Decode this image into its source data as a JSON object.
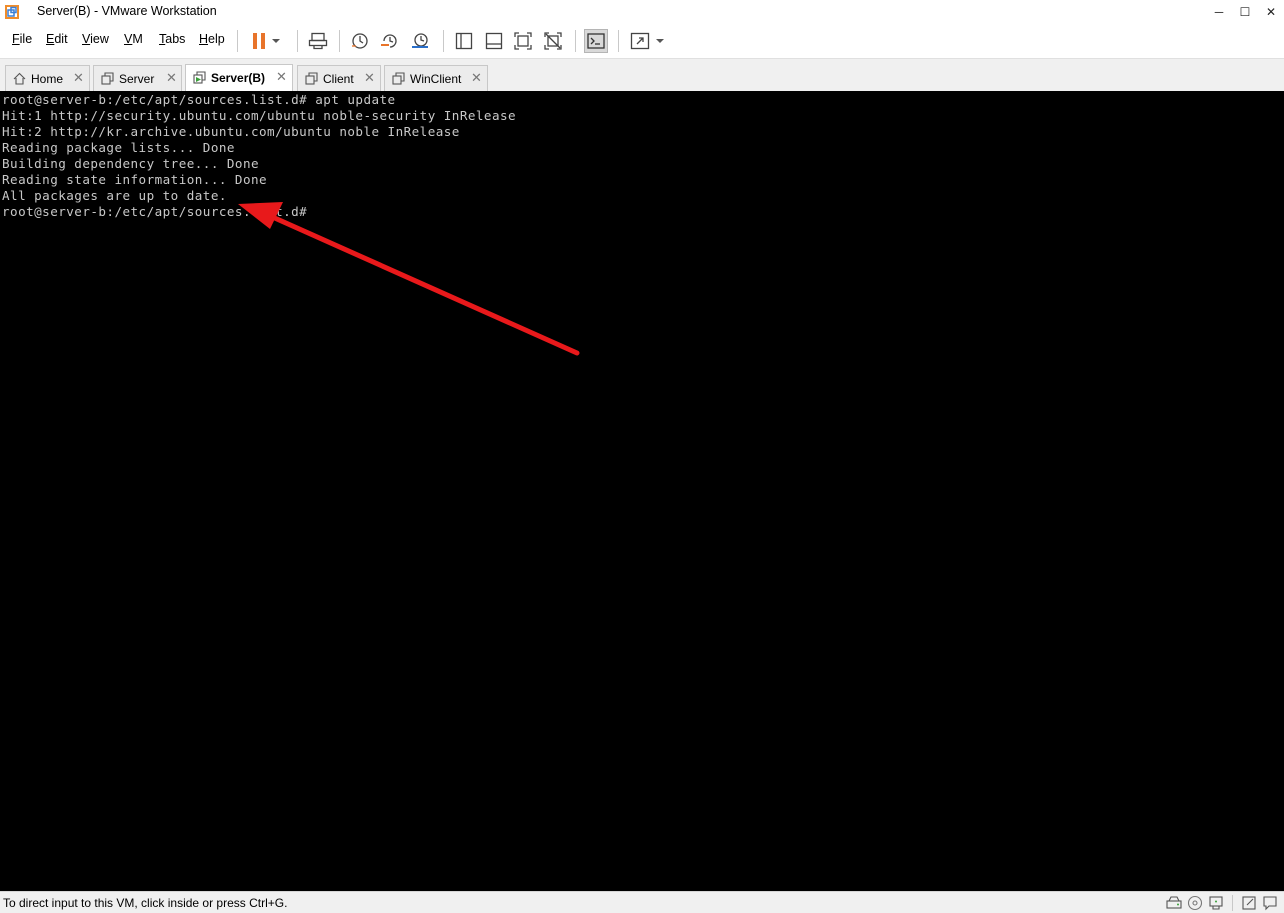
{
  "window": {
    "title": "Server(B) - VMware Workstation",
    "minimize": "─",
    "maximize": "☐",
    "close": "✕"
  },
  "menu": {
    "items": [
      {
        "label": "File",
        "mnemonic": "F",
        "rest": "ile"
      },
      {
        "label": "Edit",
        "mnemonic": "E",
        "rest": "dit"
      },
      {
        "label": "View",
        "mnemonic": "V",
        "rest": "iew"
      },
      {
        "label": "VM",
        "mnemonic": "V",
        "rest": "M"
      },
      {
        "label": "Tabs",
        "mnemonic": "T",
        "rest": "abs"
      },
      {
        "label": "Help",
        "mnemonic": "H",
        "rest": "elp"
      }
    ]
  },
  "toolbar": {
    "icons": [
      "pause-icon",
      "dropdown-icon",
      "send-ctrl-alt-del-icon",
      "snapshot-icon",
      "revert-snapshot-icon",
      "snapshot-manager-icon",
      "show-library-icon",
      "show-thumbnail-icon",
      "full-screen-icon",
      "unity-icon",
      "console-view-icon",
      "stretch-icon",
      "stretch-dropdown-icon"
    ],
    "accent": "#e8742a"
  },
  "tabs": [
    {
      "label": "Home",
      "icon": "home-icon",
      "selected": false
    },
    {
      "label": "Server",
      "icon": "vm-icon",
      "selected": false
    },
    {
      "label": "Server(B)",
      "icon": "vm-running-icon",
      "selected": true
    },
    {
      "label": "Client",
      "icon": "vm-icon",
      "selected": false
    },
    {
      "label": "WinClient",
      "icon": "vm-icon",
      "selected": false
    }
  ],
  "tab_close": "✕",
  "terminal": {
    "lines": [
      "root@server-b:/etc/apt/sources.list.d# apt update",
      "Hit:1 http://security.ubuntu.com/ubuntu noble-security InRelease",
      "Hit:2 http://kr.archive.ubuntu.com/ubuntu noble InRelease",
      "Reading package lists... Done",
      "Building dependency tree... Done",
      "Reading state information... Done",
      "All packages are up to date.",
      "root@server-b:/etc/apt/sources.list.d#"
    ],
    "background": "#000000",
    "foreground": "#c8c8c8"
  },
  "annotation": {
    "arrow_color": "#e8191b"
  },
  "statusbar": {
    "text": "To direct input to this VM, click inside or press Ctrl+G.",
    "icons": [
      "hard-disk-icon",
      "cd-icon",
      "network-icon",
      "notes-icon",
      "message-icon"
    ]
  }
}
